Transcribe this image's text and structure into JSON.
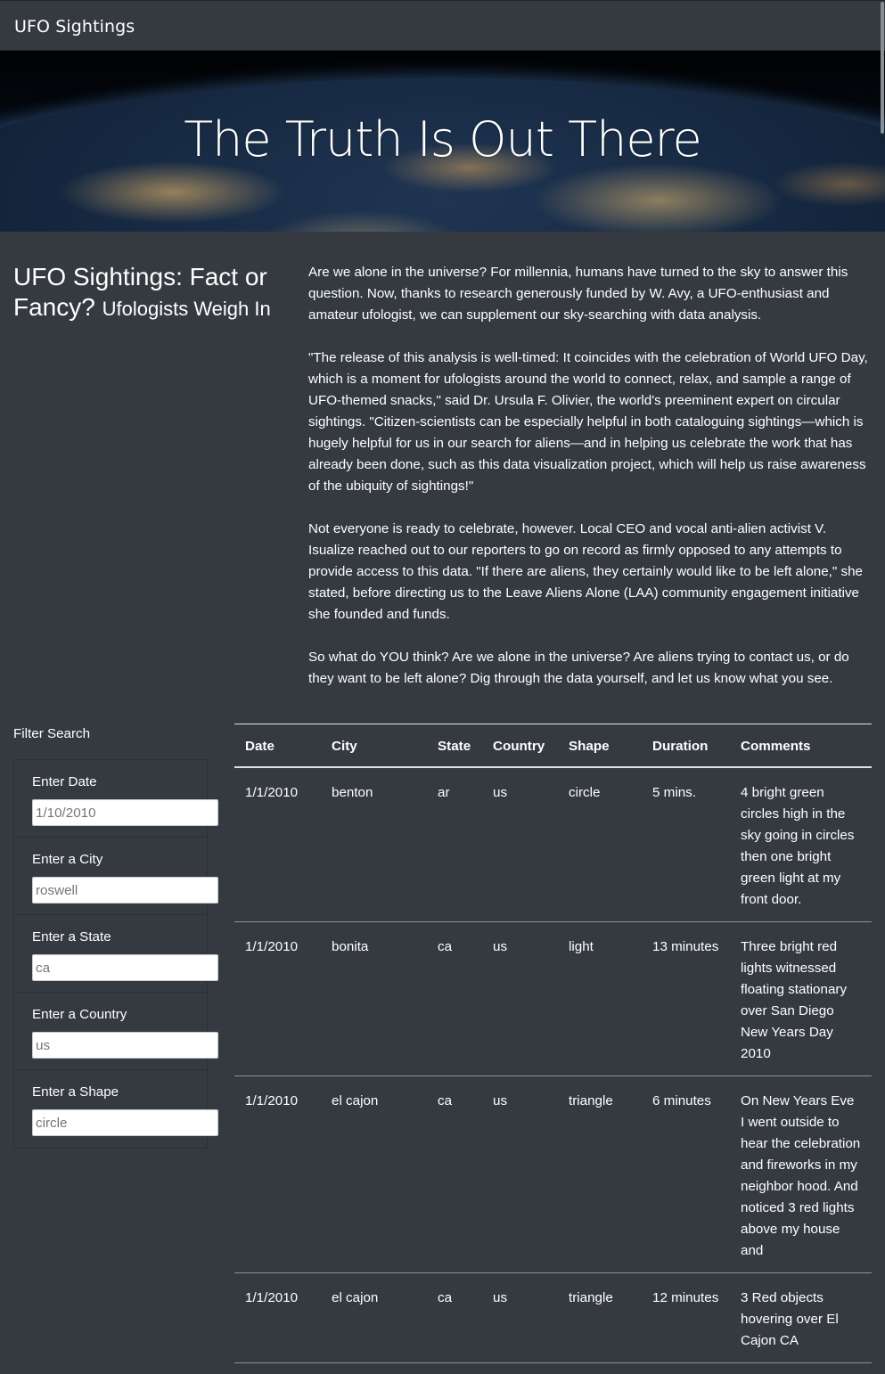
{
  "navbar": {
    "brand": "UFO Sightings"
  },
  "hero": {
    "title": "The Truth Is Out There"
  },
  "article": {
    "heading": "UFO Sightings: Fact or Fancy?",
    "subheading": "Ufologists Weigh In",
    "paragraphs": [
      "Are we alone in the universe? For millennia, humans have turned to the sky to answer this question. Now, thanks to research generously funded by W. Avy, a UFO-enthusiast and amateur ufologist, we can supplement our sky-searching with data analysis.",
      "\"The release of this analysis is well-timed: It coincides with the celebration of World UFO Day, which is a moment for ufologists around the world to connect, relax, and sample a range of UFO-themed snacks,\" said Dr. Ursula F. Olivier, the world's preeminent expert on circular sightings. \"Citizen-scientists can be especially helpful in both cataloguing sightings—which is hugely helpful for us in our search for aliens—and in helping us celebrate the work that has already been done, such as this data visualization project, which will help us raise awareness of the ubiquity of sightings!\"",
      "Not everyone is ready to celebrate, however. Local CEO and vocal anti-alien activist V. Isualize reached out to our reporters to go on record as firmly opposed to any attempts to provide access to this data. \"If there are aliens, they certainly would like to be left alone,\" she stated, before directing us to the Leave Aliens Alone (LAA) community engagement initiative she founded and funds.",
      "So what do YOU think? Are we alone in the universe? Are aliens trying to contact us, or do they want to be left alone? Dig through the data yourself, and let us know what you see."
    ]
  },
  "filters": {
    "title": "Filter Search",
    "items": [
      {
        "label": "Enter Date",
        "placeholder": "1/10/2010",
        "value": ""
      },
      {
        "label": "Enter a City",
        "placeholder": "roswell",
        "value": ""
      },
      {
        "label": "Enter a State",
        "placeholder": "ca",
        "value": ""
      },
      {
        "label": "Enter a Country",
        "placeholder": "us",
        "value": ""
      },
      {
        "label": "Enter a Shape",
        "placeholder": "circle",
        "value": ""
      }
    ]
  },
  "table": {
    "headers": [
      "Date",
      "City",
      "State",
      "Country",
      "Shape",
      "Duration",
      "Comments"
    ],
    "rows": [
      [
        "1/1/2010",
        "benton",
        "ar",
        "us",
        "circle",
        "5 mins.",
        "4 bright green circles high in the sky going in circles then one bright green light at my front door."
      ],
      [
        "1/1/2010",
        "bonita",
        "ca",
        "us",
        "light",
        "13 minutes",
        "Three bright red lights witnessed floating stationary over San Diego New Years Day 2010"
      ],
      [
        "1/1/2010",
        "el cajon",
        "ca",
        "us",
        "triangle",
        "6 minutes",
        "On New Years Eve I went outside to hear the celebration and fireworks in my neighbor hood. And noticed 3 red lights above my house and"
      ],
      [
        "1/1/2010",
        "el cajon",
        "ca",
        "us",
        "triangle",
        "12 minutes",
        "3 Red objects hovering over El Cajon CA"
      ]
    ]
  }
}
